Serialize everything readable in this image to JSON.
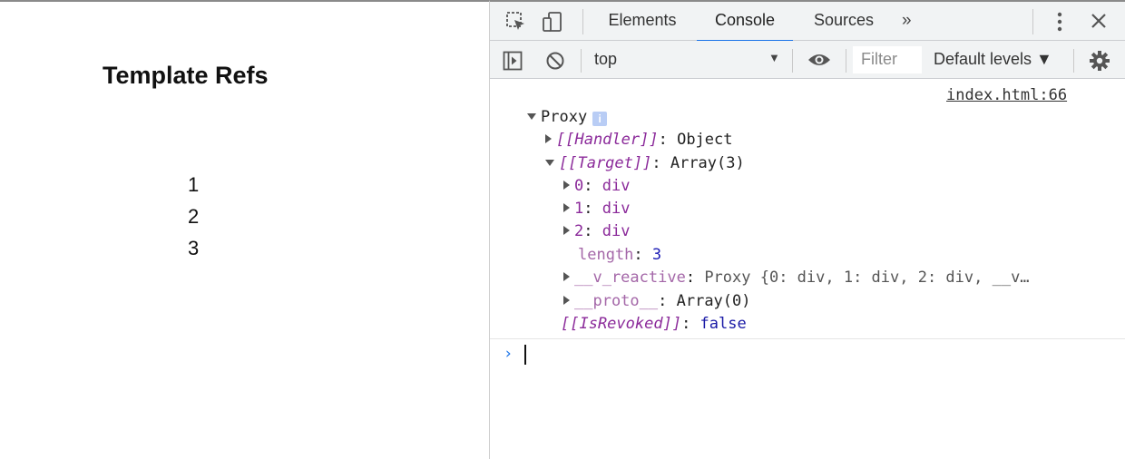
{
  "page": {
    "title": "Template Refs",
    "items": [
      "1",
      "2",
      "3"
    ]
  },
  "devtools": {
    "tabs": [
      "Elements",
      "Console",
      "Sources"
    ],
    "active_tab": "Console",
    "more_tabs_glyph": "»",
    "toolbar": {
      "context": "top",
      "filter_placeholder": "Filter",
      "levels": "Default levels ▼"
    },
    "console": {
      "source_link": "index.html:66",
      "proxy_label": "Proxy",
      "info_badge": "i",
      "handler_key": "[[Handler]]",
      "handler_val": "Object",
      "target_key": "[[Target]]",
      "target_val": "Array(3)",
      "items": [
        {
          "key": "0",
          "val": "div"
        },
        {
          "key": "1",
          "val": "div"
        },
        {
          "key": "2",
          "val": "div"
        }
      ],
      "length_key": "length",
      "length_val": "3",
      "reactive_key": "__v_reactive",
      "reactive_val": "Proxy {0: div, 1: div, 2: div, __v…",
      "proto_key": "__proto__",
      "proto_val": "Array(0)",
      "revoked_key": "[[IsRevoked]]",
      "revoked_val": "false",
      "prompt": "›"
    },
    "accent_color": "#1a73e8"
  }
}
